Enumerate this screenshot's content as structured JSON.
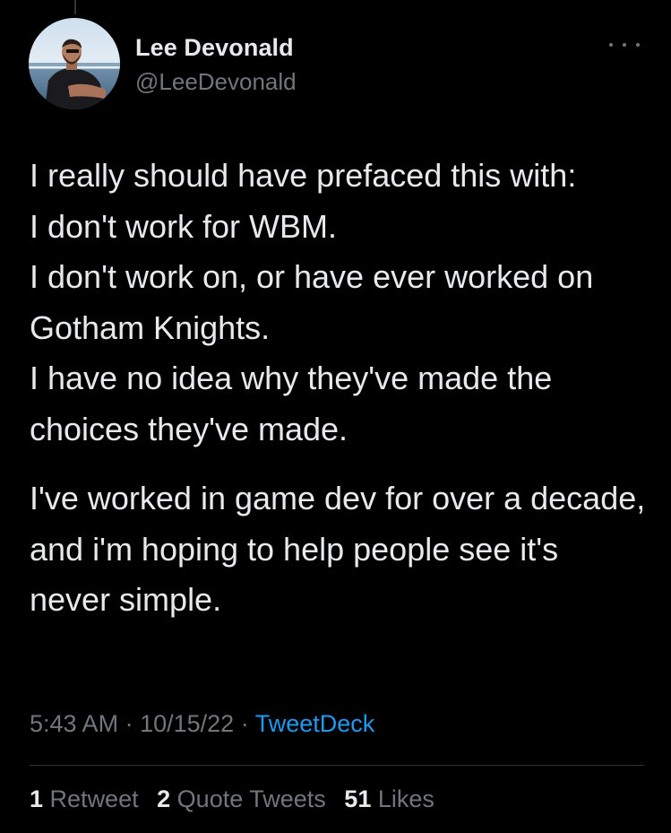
{
  "tweet": {
    "author": {
      "display_name": "Lee Devonald",
      "handle": "@LeeDevonald",
      "avatar_icon": "profile-photo"
    },
    "more_icon": "more-horizontal-icon",
    "body": {
      "paragraph1_lines": [
        "I really should have prefaced this with:",
        "I don't work for WBM.",
        "I don't work on, or have ever worked on Gotham Knights.",
        "I have no idea why they've made the choices they've made."
      ],
      "paragraph2": "I've worked in game dev for over a decade, and i'm hoping to help people see it's never simple."
    },
    "meta": {
      "time": "5:43 AM",
      "separator": "·",
      "date": "10/15/22",
      "source": "TweetDeck"
    },
    "stats": {
      "retweets_count": "1",
      "retweets_label": "Retweet",
      "quotes_count": "2",
      "quotes_label": "Quote Tweets",
      "likes_count": "51",
      "likes_label": "Likes"
    }
  },
  "colors": {
    "background": "#000000",
    "text_primary": "#e7e9ea",
    "text_secondary": "#71767b",
    "link": "#1d9bf0",
    "divider": "#2f3336"
  }
}
